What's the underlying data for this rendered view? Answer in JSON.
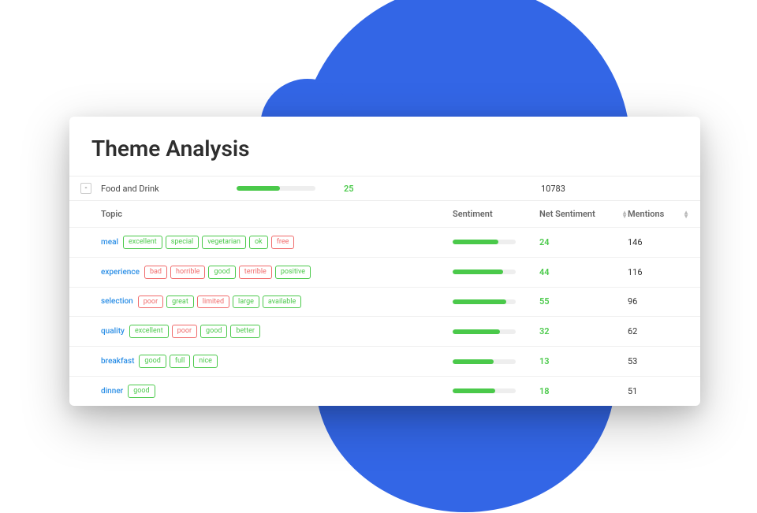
{
  "title": "Theme Analysis",
  "theme": {
    "collapse_glyph": "-",
    "name": "Food and Drink",
    "sentiment_pct": 55,
    "net_sentiment": "25",
    "mentions": "10783"
  },
  "columns": {
    "topic": "Topic",
    "sentiment": "Sentiment",
    "net_sentiment": "Net Sentiment",
    "mentions": "Mentions"
  },
  "rows": [
    {
      "topic": "meal",
      "tags": [
        {
          "label": "excellent",
          "type": "positive"
        },
        {
          "label": "special",
          "type": "positive"
        },
        {
          "label": "vegetarian",
          "type": "positive"
        },
        {
          "label": "ok",
          "type": "positive"
        },
        {
          "label": "free",
          "type": "negative"
        }
      ],
      "sentiment_pct": 72,
      "net_sentiment": "24",
      "mentions": "146"
    },
    {
      "topic": "experience",
      "tags": [
        {
          "label": "bad",
          "type": "negative"
        },
        {
          "label": "horrible",
          "type": "negative"
        },
        {
          "label": "good",
          "type": "positive"
        },
        {
          "label": "terrible",
          "type": "negative"
        },
        {
          "label": "positive",
          "type": "positive"
        }
      ],
      "sentiment_pct": 80,
      "net_sentiment": "44",
      "mentions": "116"
    },
    {
      "topic": "selection",
      "tags": [
        {
          "label": "poor",
          "type": "negative"
        },
        {
          "label": "great",
          "type": "positive"
        },
        {
          "label": "limited",
          "type": "negative"
        },
        {
          "label": "large",
          "type": "positive"
        },
        {
          "label": "available",
          "type": "positive"
        }
      ],
      "sentiment_pct": 85,
      "net_sentiment": "55",
      "mentions": "96"
    },
    {
      "topic": "quality",
      "tags": [
        {
          "label": "excellent",
          "type": "positive"
        },
        {
          "label": "poor",
          "type": "negative"
        },
        {
          "label": "good",
          "type": "positive"
        },
        {
          "label": "better",
          "type": "positive"
        }
      ],
      "sentiment_pct": 75,
      "net_sentiment": "32",
      "mentions": "62"
    },
    {
      "topic": "breakfast",
      "tags": [
        {
          "label": "good",
          "type": "positive"
        },
        {
          "label": "full",
          "type": "positive"
        },
        {
          "label": "nice",
          "type": "positive"
        }
      ],
      "sentiment_pct": 65,
      "net_sentiment": "13",
      "mentions": "53"
    },
    {
      "topic": "dinner",
      "tags": [
        {
          "label": "good",
          "type": "positive"
        }
      ],
      "sentiment_pct": 68,
      "net_sentiment": "18",
      "mentions": "51"
    }
  ]
}
